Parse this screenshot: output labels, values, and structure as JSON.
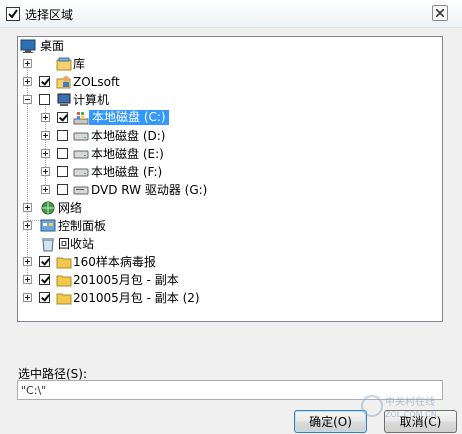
{
  "window": {
    "title": "选择区域"
  },
  "tree": {
    "root": "桌面",
    "items": [
      {
        "label": "库",
        "checked": false,
        "icon": "library-icon"
      },
      {
        "label": "ZOLsoft",
        "checked": true,
        "icon": "user-folder-icon"
      },
      {
        "label": "计算机",
        "checked": false,
        "icon": "computer-icon"
      },
      {
        "label": "本地磁盘 (C:)",
        "checked": true,
        "icon": "system-drive-icon",
        "selected": true
      },
      {
        "label": "本地磁盘 (D:)",
        "checked": false,
        "icon": "hard-drive-icon"
      },
      {
        "label": "本地磁盘 (E:)",
        "checked": false,
        "icon": "hard-drive-icon"
      },
      {
        "label": "本地磁盘 (F:)",
        "checked": false,
        "icon": "hard-drive-icon"
      },
      {
        "label": "DVD RW 驱动器 (G:)",
        "checked": false,
        "icon": "dvd-drive-icon"
      },
      {
        "label": "网络",
        "icon": "network-icon"
      },
      {
        "label": "控制面板",
        "icon": "control-panel-icon"
      },
      {
        "label": "回收站",
        "icon": "recycle-bin-icon"
      },
      {
        "label": "160样本病毒报",
        "checked": true,
        "icon": "folder-icon"
      },
      {
        "label": "201005月包 - 副本",
        "checked": true,
        "icon": "folder-icon"
      },
      {
        "label": "201005月包 - 副本 (2)",
        "checked": true,
        "icon": "folder-icon"
      }
    ]
  },
  "path": {
    "label": "选中路径(S):",
    "value": "\"C:\\\""
  },
  "buttons": {
    "ok": "确定(O)",
    "cancel": "取消(C)"
  },
  "watermark": {
    "brand": "中关村在线",
    "domain": "ZOL.COM.CN"
  }
}
